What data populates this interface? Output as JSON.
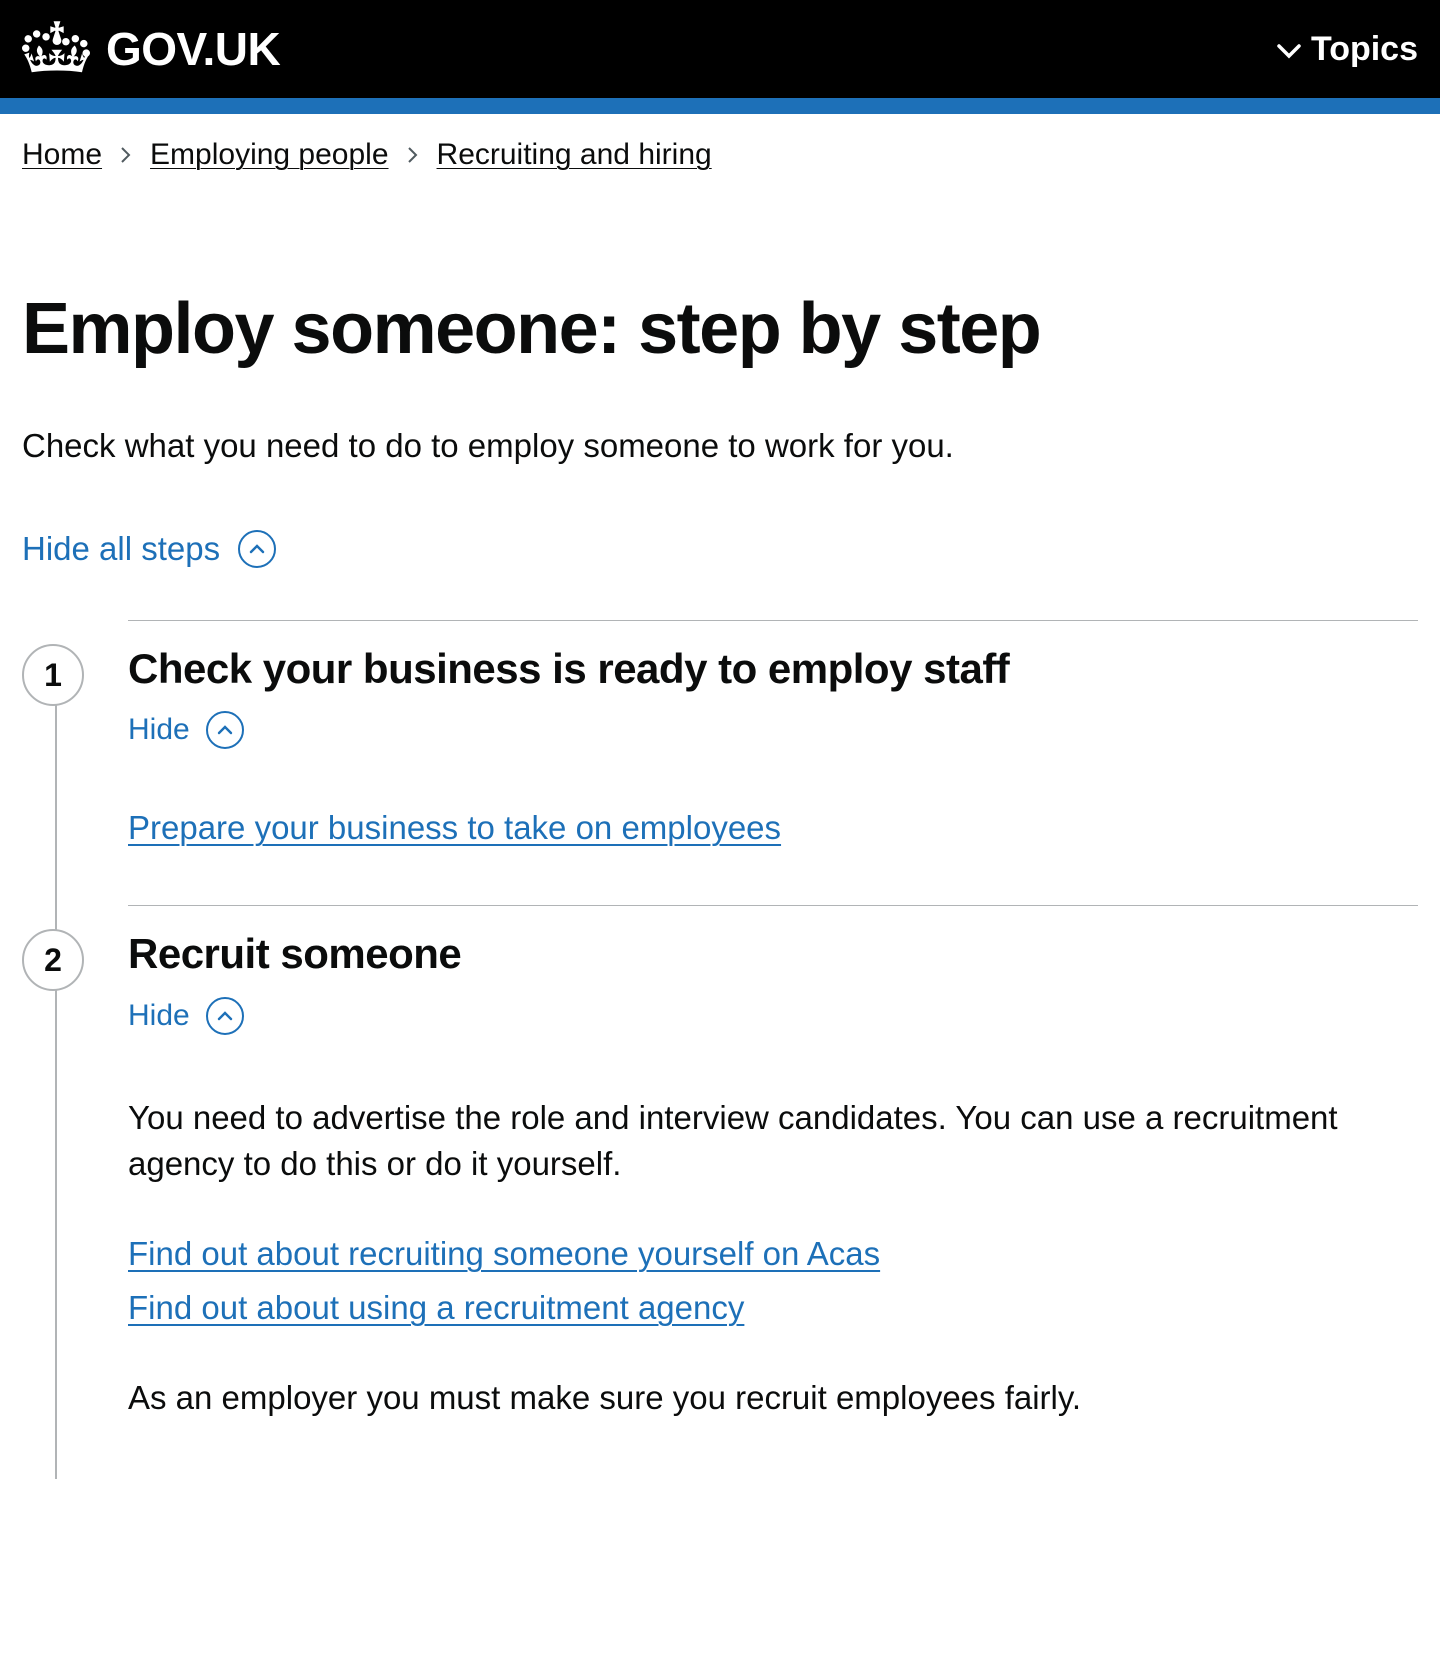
{
  "header": {
    "site_name": "GOV.UK",
    "topics_label": "Topics"
  },
  "breadcrumb": [
    {
      "label": "Home"
    },
    {
      "label": "Employing people"
    },
    {
      "label": "Recruiting and hiring"
    }
  ],
  "page": {
    "title": "Employ someone: step by step",
    "intro": "Check what you need to do to employ someone to work for you.",
    "hide_all_label": "Hide all steps"
  },
  "steps": [
    {
      "number": "1",
      "title": "Check your business is ready to employ staff",
      "hide_label": "Hide",
      "links": [
        {
          "text": "Prepare your business to take on employees"
        }
      ]
    },
    {
      "number": "2",
      "title": "Recruit someone",
      "hide_label": "Hide",
      "intro": "You need to advertise the role and interview candidates. You can use a recruitment agency to do this or do it yourself.",
      "links": [
        {
          "text": "Find out about recruiting someone yourself on Acas"
        },
        {
          "text": "Find out about using a recruitment agency"
        }
      ],
      "footer_text": "As an employer you must make sure you recruit employees fairly."
    }
  ]
}
